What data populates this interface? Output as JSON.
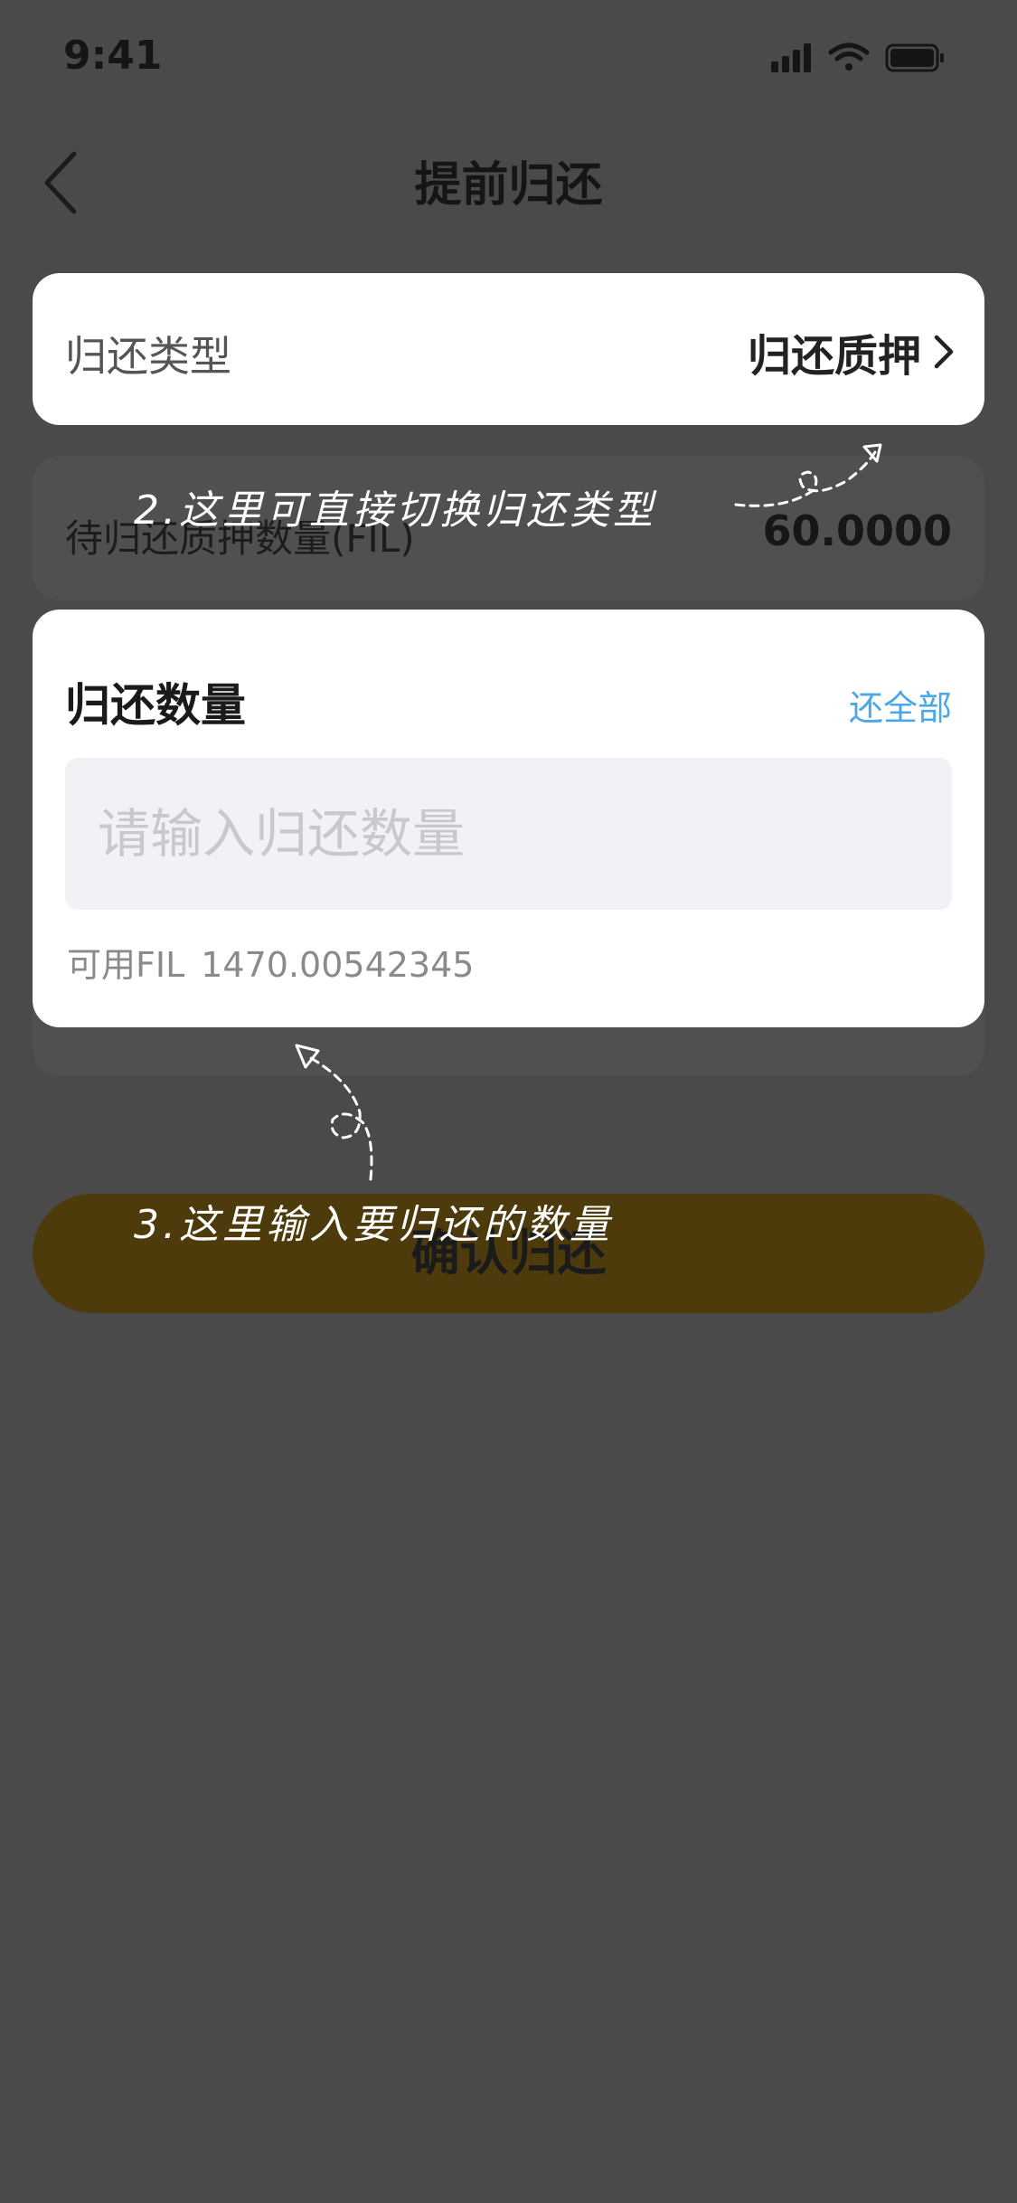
{
  "status": {
    "time": "9:41"
  },
  "nav": {
    "title": "提前归还"
  },
  "return_type": {
    "label": "归还类型",
    "value": "归还质押"
  },
  "pending": {
    "label": "待归还质押数量(FIL)",
    "value": "60.0000"
  },
  "amount": {
    "title": "归还数量",
    "return_all": "还全部",
    "input_value": "",
    "placeholder": "请输入归还数量",
    "available_label": "可用FIL",
    "available_value": "1470.00542345"
  },
  "confirm": {
    "label": "确认归还"
  },
  "annotations": {
    "switch_type": "2.这里可直接切换归还类型",
    "enter_amount": "3.这里输入要归还的数量"
  },
  "colors": {
    "overlay": "#4a4a4a",
    "card": "#ffffff",
    "accent_link": "#4aa8e8",
    "button": "#4e3b0c"
  }
}
